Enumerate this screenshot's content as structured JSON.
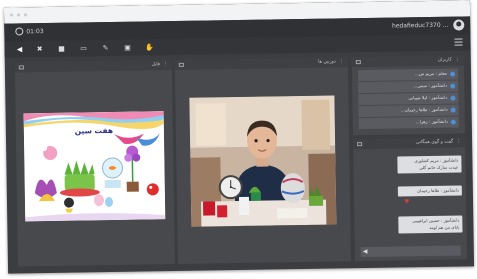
{
  "browser": {
    "url": ""
  },
  "app": {
    "time": "01:03",
    "user_name": "... hedafieduc7370"
  },
  "toolbar": {
    "tools": [
      {
        "name": "speaker-icon",
        "glyph": "◀"
      },
      {
        "name": "microphone-off-icon",
        "glyph": "✖"
      },
      {
        "name": "camera-icon",
        "glyph": "■"
      },
      {
        "name": "screen-share-icon",
        "glyph": "▭"
      },
      {
        "name": "pen-icon",
        "glyph": "✎"
      },
      {
        "name": "file-icon",
        "glyph": "▣"
      },
      {
        "name": "hand-icon",
        "glyph": "✋"
      }
    ]
  },
  "left_panel": {
    "title": "فایل",
    "slide_title": "هفت سین"
  },
  "center_panel": {
    "title": "دوربین ها"
  },
  "users_panel": {
    "title": "کاربران",
    "users": [
      "معلم : مریم س...",
      "دانشآموز : سمی...",
      "دانشآموز : لیلا شیبانی",
      "دانشآموز : طاها رحیمان...",
      "دانشآموز : زهرا..."
    ]
  },
  "chat_panel": {
    "title": "گفت و گوی همگانی",
    "messages": [
      {
        "line1": "دانشآموز : مریم کشاوری",
        "line2": "عیدت مبارک خانم گلی"
      },
      {
        "line1": "دانشآموز : طاها رحیمان",
        "line2": ""
      },
      {
        "line1": "دانشآموز : حسین ابراهیمی",
        "line2": "بابای من هم اومد"
      }
    ]
  }
}
